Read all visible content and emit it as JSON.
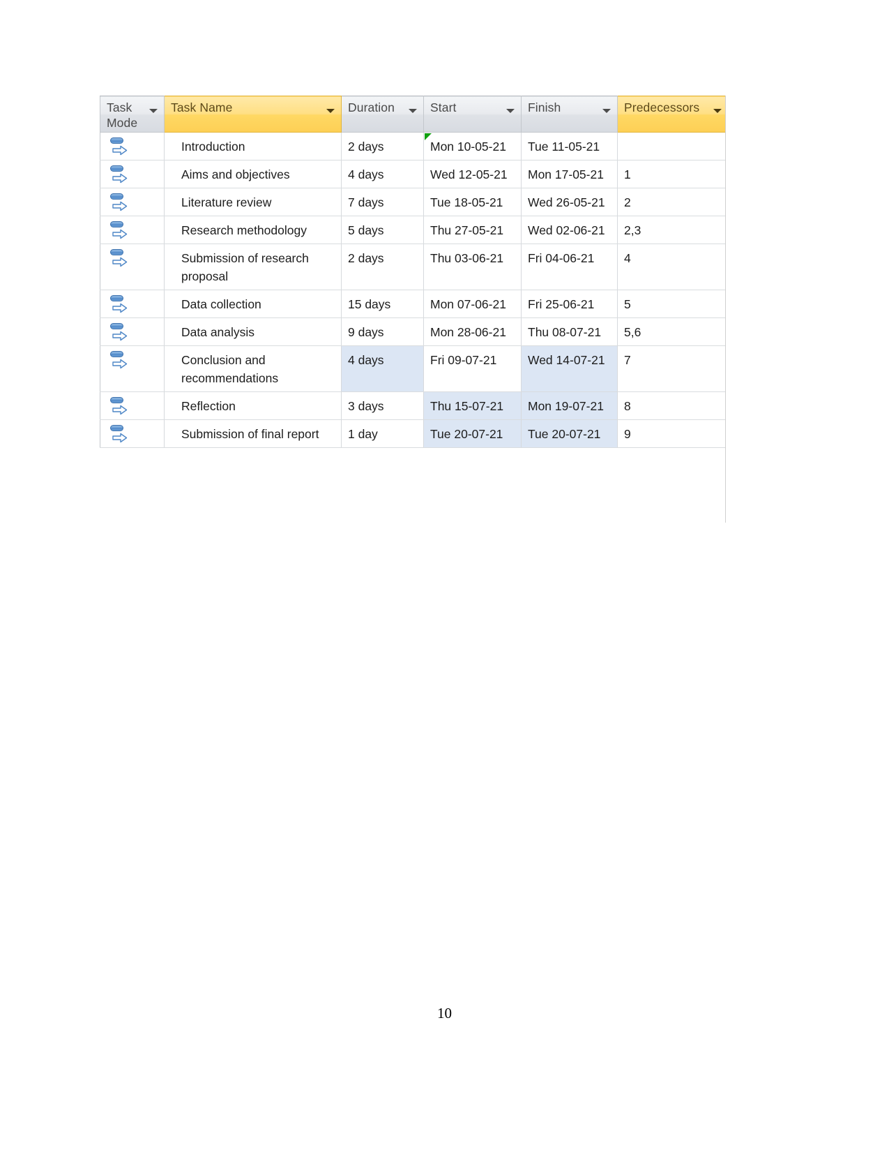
{
  "document": {
    "page_number": "10"
  },
  "table": {
    "name": "project-schedule-grid",
    "columns": [
      {
        "key": "task_mode",
        "label": "Task\nMode",
        "highlight": false,
        "has_filter_arrow": true
      },
      {
        "key": "task_name",
        "label": "Task Name",
        "highlight": true,
        "has_filter_arrow": true
      },
      {
        "key": "duration",
        "label": "Duration",
        "highlight": false,
        "has_filter_arrow": true
      },
      {
        "key": "start",
        "label": "Start",
        "highlight": false,
        "has_filter_arrow": true
      },
      {
        "key": "finish",
        "label": "Finish",
        "highlight": false,
        "has_filter_arrow": true
      },
      {
        "key": "predecessors",
        "label": "Predecessors",
        "highlight": true,
        "has_filter_arrow": true
      }
    ],
    "rows": [
      {
        "id": 1,
        "task_mode_icon": "auto-scheduled-icon",
        "task_name": "Introduction",
        "duration": "2 days",
        "start": "Mon 10-05-21",
        "finish": "Tue 11-05-21",
        "predecessors": "",
        "start_marker": "green-corner-marker",
        "selected_cells": []
      },
      {
        "id": 2,
        "task_mode_icon": "auto-scheduled-icon",
        "task_name": "Aims and objectives",
        "duration": "4 days",
        "start": "Wed 12-05-21",
        "finish": "Mon 17-05-21",
        "predecessors": "1",
        "start_marker": "",
        "selected_cells": []
      },
      {
        "id": 3,
        "task_mode_icon": "auto-scheduled-icon",
        "task_name": "Literature review",
        "duration": "7 days",
        "start": "Tue 18-05-21",
        "finish": "Wed 26-05-21",
        "predecessors": "2",
        "start_marker": "",
        "selected_cells": []
      },
      {
        "id": 4,
        "task_mode_icon": "auto-scheduled-icon",
        "task_name": "Research methodology",
        "duration": "5 days",
        "start": "Thu 27-05-21",
        "finish": "Wed 02-06-21",
        "predecessors": "2,3",
        "start_marker": "",
        "selected_cells": []
      },
      {
        "id": 5,
        "task_mode_icon": "auto-scheduled-icon",
        "task_name": "Submission of research proposal",
        "duration": "2 days",
        "start": "Thu 03-06-21",
        "finish": "Fri 04-06-21",
        "predecessors": "4",
        "start_marker": "",
        "selected_cells": []
      },
      {
        "id": 6,
        "task_mode_icon": "auto-scheduled-icon",
        "task_name": "Data collection",
        "duration": "15 days",
        "start": "Mon 07-06-21",
        "finish": "Fri 25-06-21",
        "predecessors": "5",
        "start_marker": "",
        "selected_cells": []
      },
      {
        "id": 7,
        "task_mode_icon": "auto-scheduled-icon",
        "task_name": "Data analysis",
        "duration": "9 days",
        "start": "Mon 28-06-21",
        "finish": "Thu 08-07-21",
        "predecessors": "5,6",
        "start_marker": "",
        "selected_cells": []
      },
      {
        "id": 8,
        "task_mode_icon": "auto-scheduled-icon",
        "task_name": "Conclusion and recommendations",
        "duration": "4 days",
        "start": "Fri 09-07-21",
        "finish": "Wed 14-07-21",
        "predecessors": "7",
        "start_marker": "",
        "selected_cells": [
          "duration",
          "finish"
        ]
      },
      {
        "id": 9,
        "task_mode_icon": "auto-scheduled-icon",
        "task_name": "Reflection",
        "duration": "3 days",
        "start": "Thu 15-07-21",
        "finish": "Mon 19-07-21",
        "predecessors": "8",
        "start_marker": "",
        "selected_cells": [
          "start",
          "finish"
        ]
      },
      {
        "id": 10,
        "task_mode_icon": "auto-scheduled-icon",
        "task_name": "Submission of final report",
        "duration": "1 day",
        "start": "Tue 20-07-21",
        "finish": "Tue 20-07-21",
        "predecessors": "9",
        "start_marker": "",
        "selected_cells": [
          "start",
          "finish"
        ]
      }
    ]
  },
  "colors": {
    "header_gold": "#ffd863",
    "header_gray": "#e2e5ea",
    "selection_blue": "#dce6f4",
    "icon_blue": "#4d86c6",
    "marker_green": "#10a010",
    "grid_line": "#d6d9dd"
  }
}
